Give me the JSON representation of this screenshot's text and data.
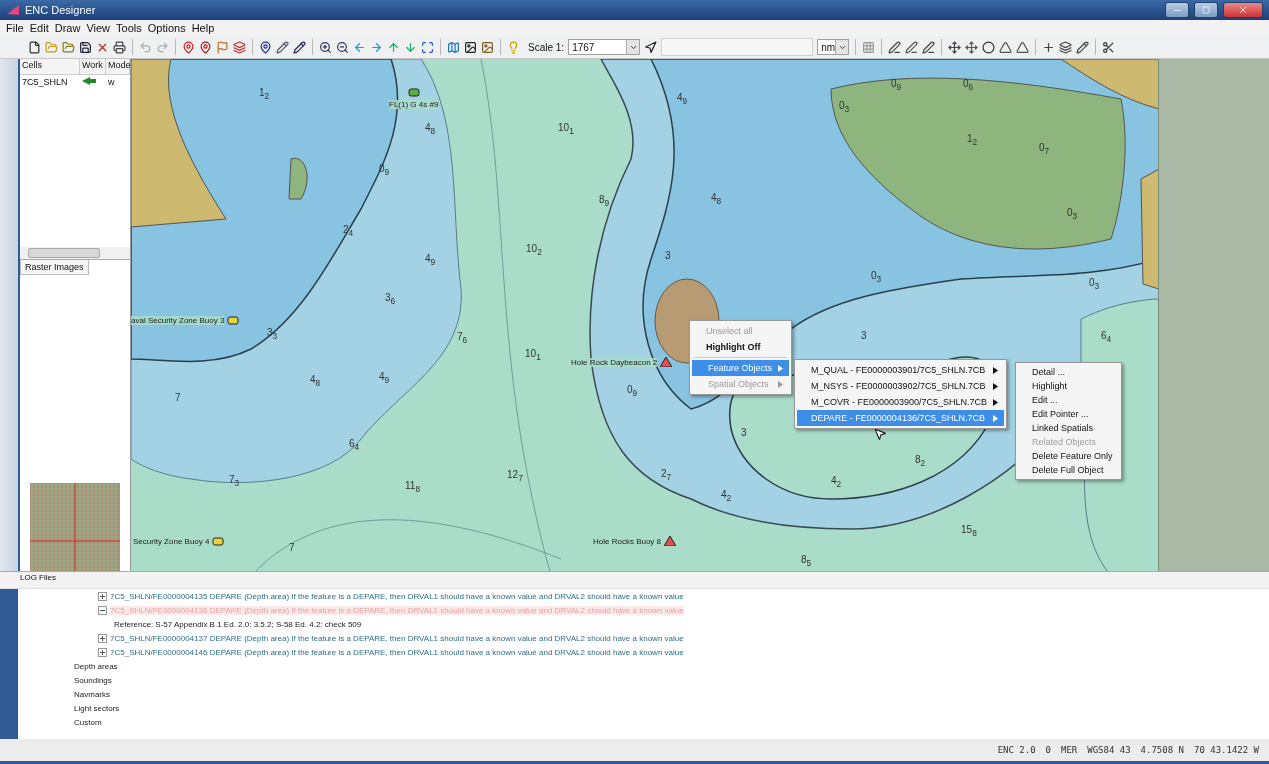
{
  "window": {
    "title": "ENC Designer"
  },
  "menu": [
    "File",
    "Edit",
    "Draw",
    "View",
    "Tools",
    "Options",
    "Help"
  ],
  "toolbar": {
    "scale_label": "Scale 1:",
    "scale_value": "1767",
    "unit_value": "nm"
  },
  "cells_panel": {
    "columns": [
      "Cells",
      "Work",
      "Mode"
    ],
    "rows": [
      {
        "cell": "7C5_SHLN",
        "work": true,
        "mode": "w"
      }
    ],
    "tab": "Raster Images"
  },
  "map": {
    "soundings": [
      "1$_{2}$",
      "4$_{8}$",
      "0$_{9}$",
      "2$_{4}$",
      "4$_{9}$",
      "3$_{6}$",
      "3$_{3}$",
      "4$_{8}$",
      "4$_{9}$",
      "10$_{1}$",
      "10$_{2}$",
      "8$_{9}$",
      "7$_{6}$",
      "10$_{1}$",
      "6$_{4}$",
      "7$_{3}$",
      "11$_{8}$",
      "7",
      "7",
      "12$_{7}$",
      "3",
      "4$_{9}$",
      "4$_{8}$",
      "0$_{3}$",
      "0$_{9}$",
      "0$_{6}$",
      "1$_{2}$",
      "0$_{7}$",
      "0$_{3}$",
      "0$_{3}$",
      "0$_{3}$",
      "6$_{4}$",
      "0$_{9}$",
      "3",
      "2$_{7}$",
      "4$_{2}$",
      "4$_{2}$",
      "8$_{2}$",
      "15$_{8}$",
      "8$_{5}$",
      "3"
    ],
    "labels": [
      {
        "text": "FL(1) G 4s #9",
        "kind": "green"
      },
      {
        "text": "aval Security Zone Buoy 3",
        "kind": "yellow"
      },
      {
        "text": "Security Zone Buoy 4",
        "kind": "yellow"
      },
      {
        "text": "Hole Rock Daybeacon 2",
        "kind": "red"
      },
      {
        "text": "Hole Rocks Buoy 8",
        "kind": "red"
      }
    ]
  },
  "context_menu": [
    {
      "label": "Unselect all",
      "disabled": true,
      "bold": false,
      "submenu": false,
      "selected": false
    },
    {
      "label": "Highlight Off",
      "disabled": false,
      "bold": true,
      "submenu": false,
      "selected": false
    },
    {
      "label": "Feature Objects",
      "disabled": false,
      "bold": false,
      "submenu": true,
      "selected": true
    },
    {
      "label": "Spatial Objects",
      "disabled": true,
      "bold": false,
      "submenu": true,
      "selected": false
    }
  ],
  "feature_menu": [
    {
      "label": "M_QUAL - FE0000003901/7C5_SHLN.7CB",
      "selected": false
    },
    {
      "label": "M_NSYS - FE0000003902/7C5_SHLN.7CB",
      "selected": false
    },
    {
      "label": "M_COVR - FE0000003900/7C5_SHLN.7CB",
      "selected": false
    },
    {
      "label": "DEPARE - FE0000004136/7C5_SHLN.7CB",
      "selected": true
    }
  ],
  "object_menu": [
    {
      "label": "Detail ...",
      "disabled": false
    },
    {
      "label": "Highlight",
      "disabled": false
    },
    {
      "label": "Edit ...",
      "disabled": false
    },
    {
      "label": "Edit Pointer ...",
      "disabled": false
    },
    {
      "label": "Linked Spatials",
      "disabled": false
    },
    {
      "label": "Related Objects",
      "disabled": true
    },
    {
      "label": "Delete Feature Only",
      "disabled": false
    },
    {
      "label": "Delete Full Object",
      "disabled": false
    }
  ],
  "log": {
    "title": "LOG Files",
    "entries": [
      {
        "text": "7C5_SHLN/FE0000004135 DEPARE (Depth area) If the feature is a DEPARE, then DRVAL1 should have a known value and DRVAL2 should have a known value",
        "expanded": false,
        "selected": false
      },
      {
        "text": "7C5_SHLN/FE0000004136 DEPARE (Depth area) If the feature is a DEPARE, then DRVAL1 should have a known value and DRVAL2 should have a known value",
        "expanded": true,
        "selected": true,
        "children": [
          "Reference: S-57 Appendix B.1 Ed. 2.0: 3.5.2; S-58 Ed. 4.2: check 509"
        ]
      },
      {
        "text": "7C5_SHLN/FE0000004137 DEPARE (Depth area) If the feature is a DEPARE, then DRVAL1 should have a known value and DRVAL2 should have a known value",
        "expanded": false,
        "selected": false
      },
      {
        "text": "7C5_SHLN/FE0000004146 DEPARE (Depth area) If the feature is a DEPARE, then DRVAL1 should have a known value and DRVAL2 should have a known value",
        "expanded": false,
        "selected": false
      }
    ],
    "categories": [
      "Depth areas",
      "Soundings",
      "Navmarks",
      "Light sectors",
      "Custom"
    ]
  },
  "status_bar": [
    "ENC 2.0",
    "0",
    "MER",
    "WGS84 43",
    "4.7508 N",
    "70 43.1422 W"
  ]
}
